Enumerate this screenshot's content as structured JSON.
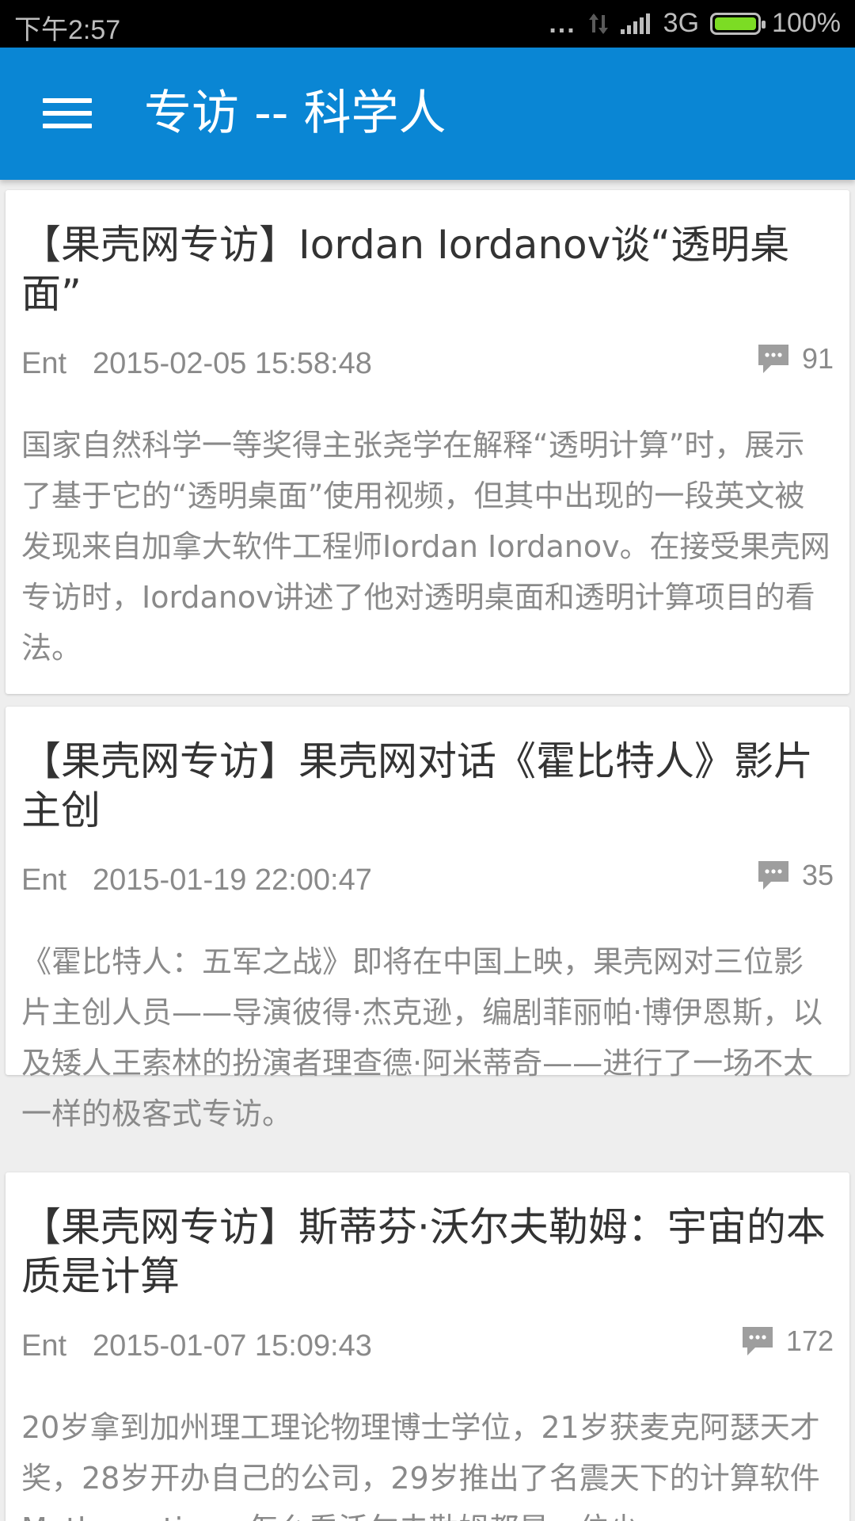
{
  "status_bar": {
    "time": "下午2:57",
    "dots": "...",
    "network_type": "3G",
    "battery_level": "100%",
    "battery_fraction": 1.0
  },
  "app_bar": {
    "title": "专访 -- 科学人",
    "menu_icon": "hamburger-menu-icon"
  },
  "articles": [
    {
      "title": "【果壳网专访】Iordan Iordanov谈“透明桌面”",
      "author": "Ent",
      "datetime": "2015-02-05 15:58:48",
      "comments": "91",
      "summary": "国家自然科学一等奖得主张尧学在解释“透明计算”时，展示了基于它的“透明桌面”使用视频，但其中出现的一段英文被发现来自加拿大软件工程师Iordan Iordanov。在接受果壳网专访时，Iordanov讲述了他对透明桌面和透明计算项目的看法。"
    },
    {
      "title": "【果壳网专访】果壳网对话《霍比特人》影片主创",
      "author": "Ent",
      "datetime": "2015-01-19 22:00:47",
      "comments": "35",
      "summary": "《霍比特人：五军之战》即将在中国上映，果壳网对三位影片主创人员——导演彼得·杰克逊，编剧菲丽帕·博伊恩斯，以及矮人王索林的扮演者理查德·阿米蒂奇——进行了一场不太一样的极客式专访。"
    },
    {
      "title": "【果壳网专访】斯蒂芬·沃尔夫勒姆：宇宙的本质是计算",
      "author": "Ent",
      "datetime": "2015-01-07 15:09:43",
      "comments": "172",
      "summary": "20岁拿到加州理工理论物理博士学位，21岁获麦克阿瑟天才奖，28岁开办自己的公司，29岁推出了名震天下的计算软件Mathematica。怎么看沃尔夫勒姆都是一位少"
    }
  ],
  "colors": {
    "app_bar": "#0a86d4",
    "status_bar": "#000000",
    "background": "#eeeeee",
    "card": "#ffffff",
    "title_text": "#333333",
    "secondary_text": "#8a8a8a",
    "battery": "#7cdc24"
  }
}
